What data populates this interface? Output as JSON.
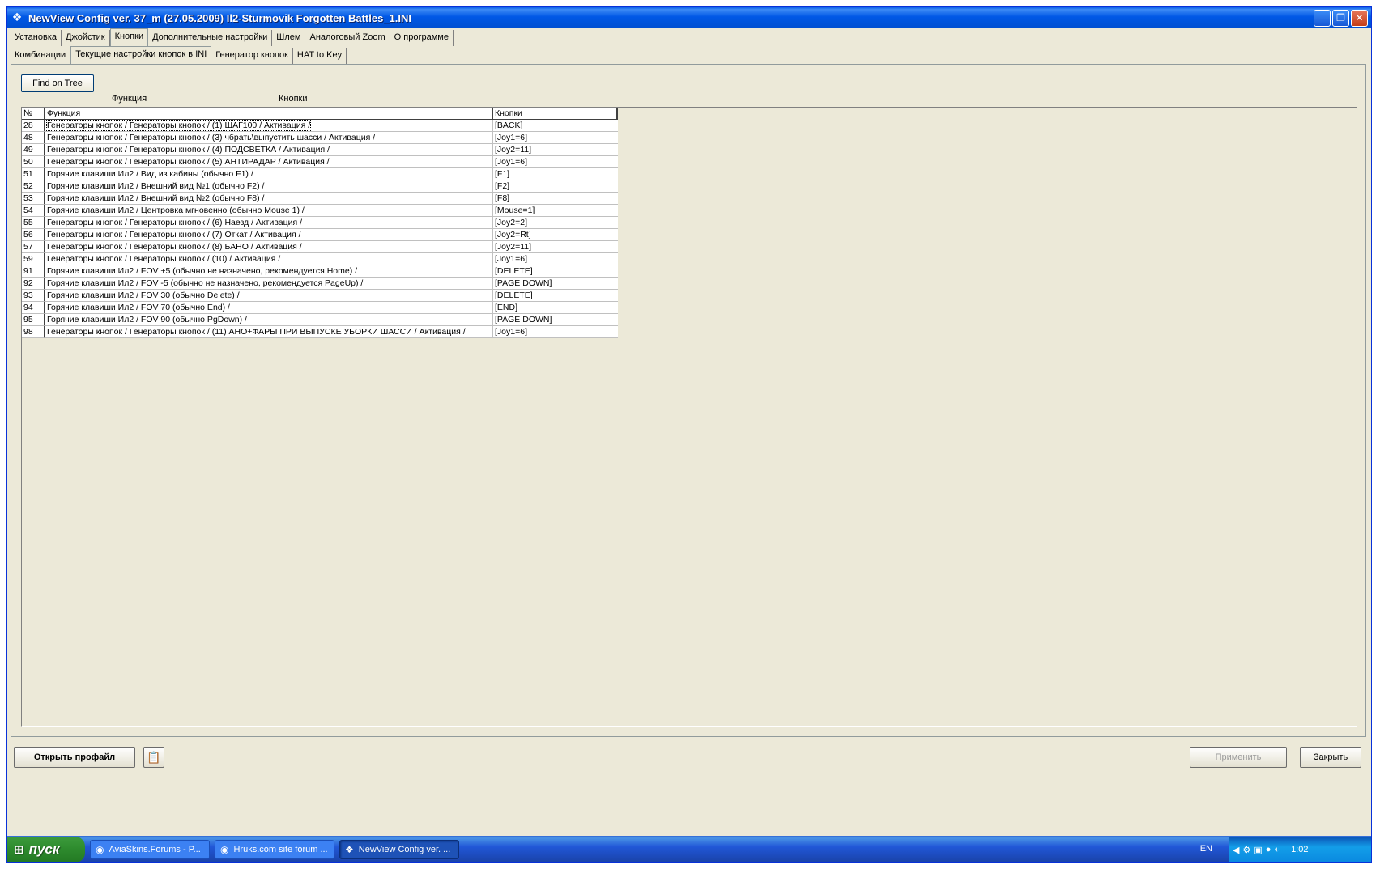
{
  "window": {
    "title": "NewView Config ver. 37_m (27.05.2009) Il2-Sturmovik Forgotten Battles_1.INI",
    "controls": {
      "minimize": "_",
      "restore": "❐",
      "close": "✕"
    }
  },
  "tabs_main": [
    "Установка",
    "Джойстик",
    "Кнопки",
    "Дополнительные настройки",
    "Шлем",
    "Аналоговый Zoom",
    "О программе"
  ],
  "tabs_sub": [
    "Комбинации",
    "Текущие настройки кнопок в INI",
    "Генератор кнопок",
    "HAT to Key"
  ],
  "panel": {
    "find_button": "Find on Tree",
    "label_function": "Функция",
    "label_buttons": "Кнопки"
  },
  "grid": {
    "headers": {
      "num": "№",
      "function": "Функция",
      "buttons": "Кнопки"
    },
    "rows": [
      {
        "n": "28",
        "f": "Генераторы кнопок  / Генераторы кнопок / (1) ШАГ100 / Активация /",
        "k": "[BACK]"
      },
      {
        "n": "48",
        "f": "Генераторы кнопок  / Генераторы кнопок / (3) чбрать\\выпустить шасси / Активация /",
        "k": "[Joy1=6]"
      },
      {
        "n": "49",
        "f": "Генераторы кнопок  / Генераторы кнопок / (4) ПОДСВЕТКА / Активация /",
        "k": "[Joy2=11]"
      },
      {
        "n": "50",
        "f": "Генераторы кнопок  / Генераторы кнопок / (5) АНТИРАДАР / Активация /",
        "k": "[Joy1=6]"
      },
      {
        "n": "51",
        "f": "Горячие клавиши Ил2 / Вид из кабины (обычно F1) /",
        "k": "[F1]"
      },
      {
        "n": "52",
        "f": "Горячие клавиши Ил2 / Внешний вид №1 (обычно F2) /",
        "k": "[F2]"
      },
      {
        "n": "53",
        "f": "Горячие клавиши Ил2 / Внешний вид №2 (обычно F8) /",
        "k": "[F8]"
      },
      {
        "n": "54",
        "f": "Горячие клавиши Ил2 / Центровка мгновенно (обычно Mouse 1) /",
        "k": "[Mouse=1]"
      },
      {
        "n": "55",
        "f": "Генераторы кнопок  / Генераторы кнопок / (6) Наезд / Активация /",
        "k": "[Joy2=2]"
      },
      {
        "n": "56",
        "f": "Генераторы кнопок  / Генераторы кнопок / (7) Откат / Активация /",
        "k": "[Joy2=Rt]"
      },
      {
        "n": "57",
        "f": "Генераторы кнопок  / Генераторы кнопок / (8) БАНО / Активация /",
        "k": "[Joy2=11]"
      },
      {
        "n": "59",
        "f": "Генераторы кнопок  / Генераторы кнопок / (10)  / Активация /",
        "k": "[Joy1=6]"
      },
      {
        "n": "91",
        "f": "Горячие клавиши Ил2 / FOV +5 (обычно не назначено, рекомендуется Home) /",
        "k": "[DELETE]"
      },
      {
        "n": "92",
        "f": "Горячие клавиши Ил2 / FOV -5 (обычно не назначено, рекомендуется PageUp) /",
        "k": "[PAGE DOWN]"
      },
      {
        "n": "93",
        "f": "Горячие клавиши Ил2 / FOV 30 (обычно Delete) /",
        "k": "[DELETE]"
      },
      {
        "n": "94",
        "f": "Горячие клавиши Ил2 / FOV 70 (обычно End) /",
        "k": "[END]"
      },
      {
        "n": "95",
        "f": "Горячие клавиши Ил2 / FOV 90 (обычно PgDown) /",
        "k": "[PAGE DOWN]"
      },
      {
        "n": "98",
        "f": "Генераторы кнопок  / Генераторы кнопок / (11) АНО+ФАРЫ ПРИ ВЫПУСКЕ УБОРКИ ШАССИ / Активация /",
        "k": "[Joy1=6]"
      }
    ]
  },
  "bottom": {
    "open_profile": "Открыть профайл",
    "apply": "Применить",
    "close": "Закрыть"
  },
  "taskbar": {
    "start": "пуск",
    "tasks": [
      "AviaSkins.Forums - P...",
      "Hruks.com site forum ...",
      "NewView Config ver. ..."
    ],
    "lang": "EN",
    "clock": "1:02"
  }
}
